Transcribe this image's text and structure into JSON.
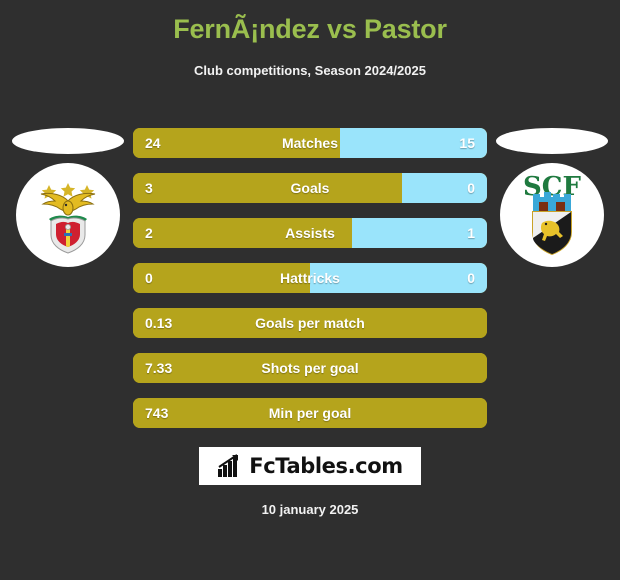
{
  "header": {
    "title": "FernÃ¡ndez vs Pastor",
    "subtitle": "Club competitions, Season 2024/2025",
    "title_color": "#9abe4e"
  },
  "teams": {
    "home": {
      "crest_name": "benfica-crest",
      "color": "#b5a41c"
    },
    "away": {
      "crest_name": "farense-scf-crest",
      "color": "#9ae4fb",
      "crest_text": "SCF"
    }
  },
  "chart_data": {
    "type": "bar",
    "title": "FernÃ¡ndez vs Pastor",
    "subtitle": "Club competitions, Season 2024/2025",
    "orientation": "horizontal-diverging",
    "series": [
      {
        "name": "FernÃ¡ndez",
        "color": "#b5a41c"
      },
      {
        "name": "Pastor",
        "color": "#9ae4fb"
      }
    ],
    "categories": [
      "Matches",
      "Goals",
      "Assists",
      "Hattricks",
      "Goals per match",
      "Shots per goal",
      "Min per goal"
    ],
    "rows": [
      {
        "label": "Matches",
        "home": "24",
        "away": "15",
        "home_pct": 58.5,
        "split": true
      },
      {
        "label": "Goals",
        "home": "3",
        "away": "0",
        "home_pct": 76.0,
        "split": true
      },
      {
        "label": "Assists",
        "home": "2",
        "away": "1",
        "home_pct": 62.0,
        "split": true
      },
      {
        "label": "Hattricks",
        "home": "0",
        "away": "0",
        "home_pct": 50.0,
        "split": true
      },
      {
        "label": "Goals per match",
        "home": "0.13",
        "away": "",
        "home_pct": 100,
        "split": false
      },
      {
        "label": "Shots per goal",
        "home": "7.33",
        "away": "",
        "home_pct": 100,
        "split": false
      },
      {
        "label": "Min per goal",
        "home": "743",
        "away": "",
        "home_pct": 100,
        "split": false
      }
    ]
  },
  "footer": {
    "brand": "FcTables.com",
    "brand_icon": "bar-chart-arrow-icon",
    "date": "10 january 2025"
  }
}
